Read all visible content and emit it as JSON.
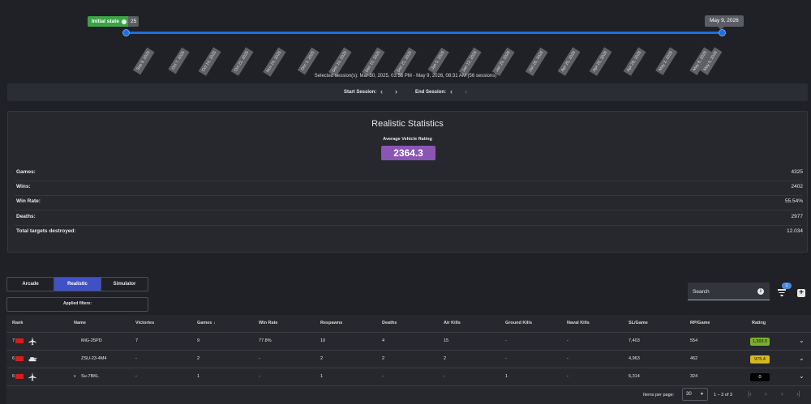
{
  "timeline": {
    "start_tooltip": "Initial state",
    "start_stub": "25",
    "end_tooltip": "May 9, 2026",
    "ticks": [
      "Sep 9, 2025",
      "Oct 7, 2025",
      "Oct 14, 2025",
      "Oct 22, 2025",
      "Nov 24, 2025",
      "Dec 2, 2025",
      "Dec 10, 2025",
      "Dec 15, 2025",
      "Dec 21, 2025",
      "Jan 5, 2026",
      "Jan 12, 2026",
      "Jan 20, 2026",
      "Jan 26, 2026",
      "Apr 20, 2026",
      "Apr 25, 2026",
      "Apr 28, 2026",
      "May 2, 2026",
      "May 8, 2026",
      "May 9, 2026"
    ],
    "selected_text": "Selected session(s): Mar 30, 2025, 03:55 PM - May 9, 2026, 08:31 AM (56 sessions)"
  },
  "session_bar": {
    "start_label": "Start Session:",
    "end_label": "End Session:"
  },
  "stats": {
    "title": "Realistic Statistics",
    "avg_label": "Average Vehicle Rating",
    "avg_value": "2364.3",
    "rows": [
      {
        "label": "Games:",
        "value": "4325"
      },
      {
        "label": "Wins:",
        "value": "2402"
      },
      {
        "label": "Win Rate:",
        "value": "55.54%"
      },
      {
        "label": "Deaths:",
        "value": "2977"
      },
      {
        "label": "Total targets destroyed:",
        "value": "12.034"
      }
    ]
  },
  "modes": [
    "Arcade",
    "Realistic",
    "Simulator"
  ],
  "active_mode": "Realistic",
  "applied_filters_label": "Applied filters:",
  "search": {
    "placeholder": "Search",
    "filter_badge": "1"
  },
  "table": {
    "columns": [
      "Rank",
      "Name",
      "Victories",
      "Games ↓",
      "Win Rate",
      "Respawns",
      "Deaths",
      "Air Kills",
      "Ground Kills",
      "Naval Kills",
      "SL/Game",
      "RP/Game",
      "Rating"
    ],
    "rows": [
      {
        "rank": "7",
        "vehicle_icon": "jet-icon",
        "name": "MiG-25PD",
        "victories": "7",
        "games": "9",
        "win_rate": "77.8%",
        "respawns": "10",
        "deaths": "4",
        "air_kills": "15",
        "ground_kills": "-",
        "naval_kills": "-",
        "sl_game": "7,403",
        "rp_game": "554",
        "rating": "1,393.5",
        "rating_color": "#7ab02d"
      },
      {
        "rank": "6",
        "vehicle_icon": "tank-icon",
        "name": "ZSU-23-4M4",
        "victories": "-",
        "games": "2",
        "win_rate": "-",
        "respawns": "2",
        "deaths": "2",
        "air_kills": "2",
        "ground_kills": "-",
        "naval_kills": "-",
        "sl_game": "4,963",
        "rp_game": "462",
        "rating": "975.4",
        "rating_color": "#d4b81e"
      },
      {
        "rank": "6",
        "vehicle_icon": "jet-icon",
        "name": "Su-7BKL",
        "victories": "-",
        "games": "1",
        "win_rate": "-",
        "respawns": "1",
        "deaths": "-",
        "air_kills": "-",
        "ground_kills": "1",
        "naval_kills": "-",
        "sl_game": "6,314",
        "rp_game": "324",
        "rating": "0",
        "rating_color": "#000000"
      }
    ],
    "footer": {
      "items_per_page_label": "Items per page:",
      "items_per_page": "30",
      "range": "1 – 3 of 3"
    }
  }
}
